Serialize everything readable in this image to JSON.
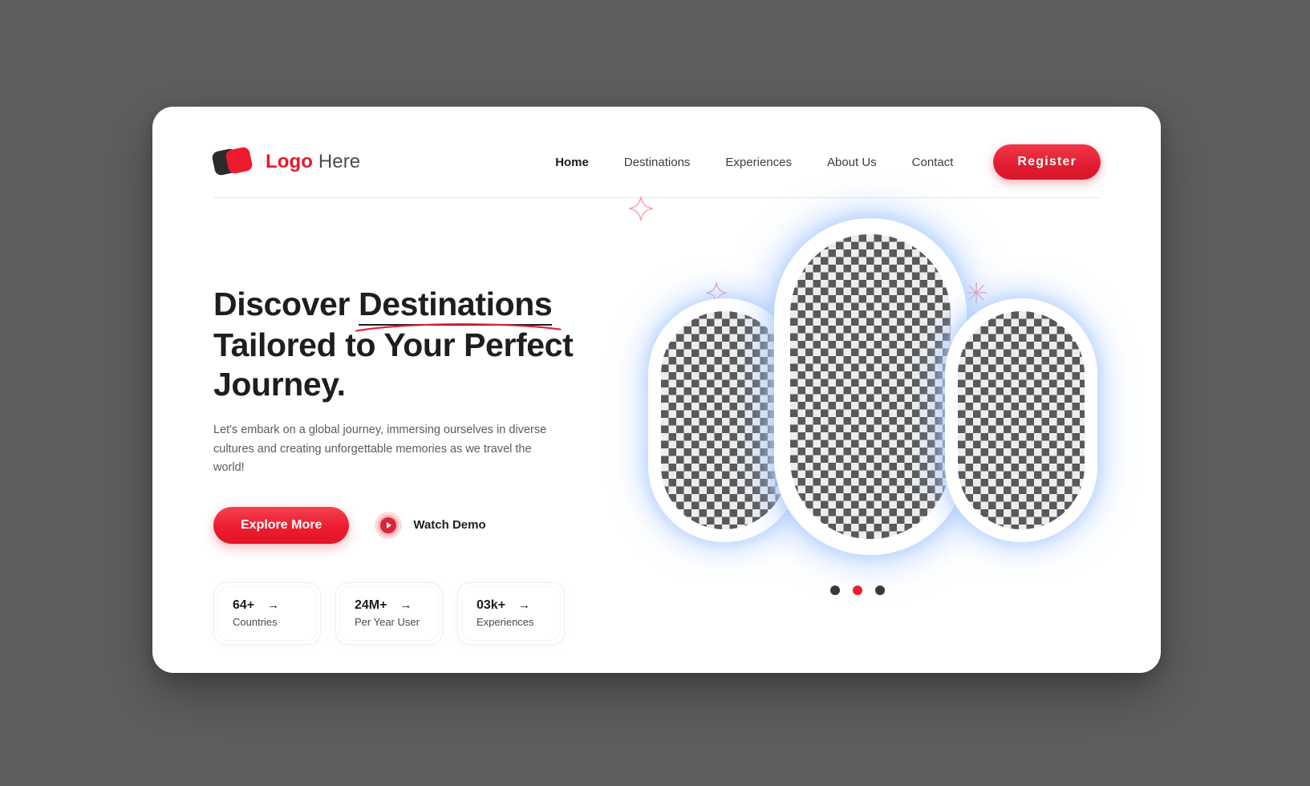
{
  "theme": {
    "background": "#5e5e5e",
    "card_background": "#ffffff",
    "accent_red": "#e8192c",
    "accent_red_dark": "#d81629",
    "text_dark": "#1e1e1e",
    "text_muted": "#5c5c5c",
    "glow_blue": "#a8c8ff"
  },
  "header": {
    "brand": {
      "logo_icon": "stacked-squares-logo-icon",
      "name_bold": "Logo",
      "name_regular": "Here"
    },
    "nav": [
      {
        "label": "Home",
        "active": true
      },
      {
        "label": "Destinations",
        "active": false
      },
      {
        "label": "Experiences",
        "active": false
      },
      {
        "label": "About Us",
        "active": false
      },
      {
        "label": "Contact",
        "active": false
      }
    ],
    "register_label": "Register"
  },
  "hero": {
    "title_part1": "Discover ",
    "title_highlight": "Destinations",
    "title_part2": " Tailored to Your Perfect Journey.",
    "paragraph": "Let's embark on a global journey, immersing ourselves in diverse cultures and creating unforgettable memories as we travel the world!",
    "primary_cta": "Explore More",
    "secondary_cta": "Watch Demo",
    "play_icon": "play-icon",
    "stats": [
      {
        "value": "64+",
        "label": "Countries",
        "arrow": "→"
      },
      {
        "value": "24M+",
        "label": "Per Year User",
        "arrow": "→"
      },
      {
        "value": "03k+",
        "label": "Experiences",
        "arrow": "→"
      }
    ]
  },
  "carousel": {
    "slides": [
      {
        "name": "photo-left",
        "placeholder": "transparent-checkerboard"
      },
      {
        "name": "photo-center",
        "placeholder": "transparent-checkerboard"
      },
      {
        "name": "photo-right",
        "placeholder": "transparent-checkerboard"
      }
    ],
    "dots": [
      {
        "active": false
      },
      {
        "active": true
      },
      {
        "active": false
      }
    ],
    "sparkles": [
      "four-point-sparkle-icon",
      "four-point-sparkle-icon",
      "eight-point-sparkle-icon"
    ]
  }
}
